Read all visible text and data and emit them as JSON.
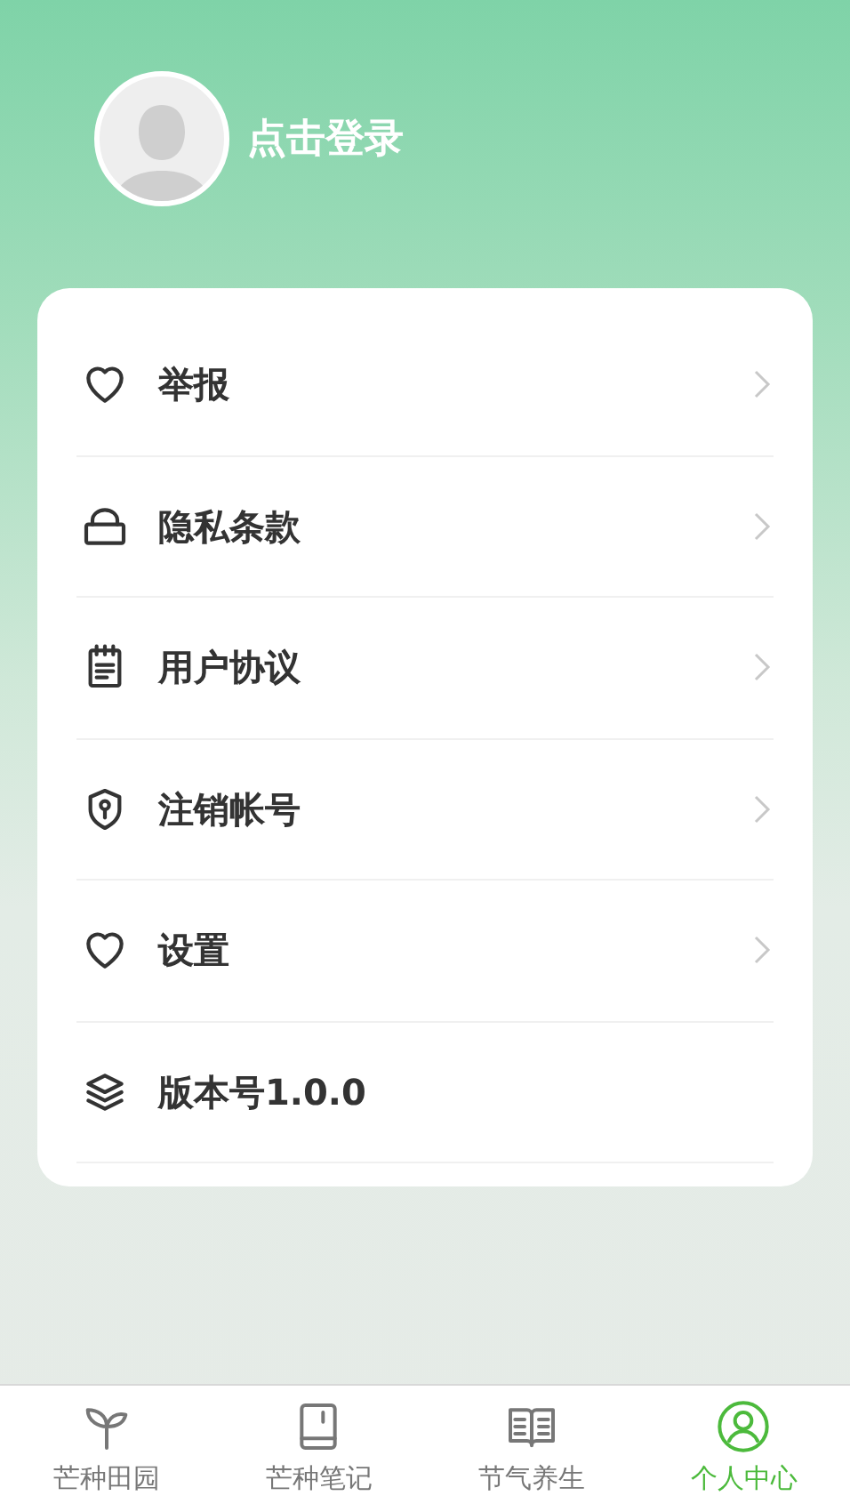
{
  "profile": {
    "login_text": "点击登录"
  },
  "menu": [
    {
      "kind": "report",
      "label": "举报",
      "has_arrow": true
    },
    {
      "kind": "privacy",
      "label": "隐私条款",
      "has_arrow": true
    },
    {
      "kind": "agreement",
      "label": "用户协议",
      "has_arrow": true
    },
    {
      "kind": "account",
      "label": "注销帐号",
      "has_arrow": true
    },
    {
      "kind": "settings",
      "label": "设置",
      "has_arrow": true
    },
    {
      "kind": "version",
      "label": "版本号1.0.0",
      "has_arrow": false
    }
  ],
  "tab_bar": [
    {
      "kind": "garden",
      "label": "芒种田园",
      "selected": false
    },
    {
      "kind": "notes",
      "label": "芒种笔记",
      "selected": false
    },
    {
      "kind": "terms",
      "label": "节气养生",
      "selected": false
    },
    {
      "kind": "profile",
      "label": "个人中心",
      "selected": true
    }
  ]
}
